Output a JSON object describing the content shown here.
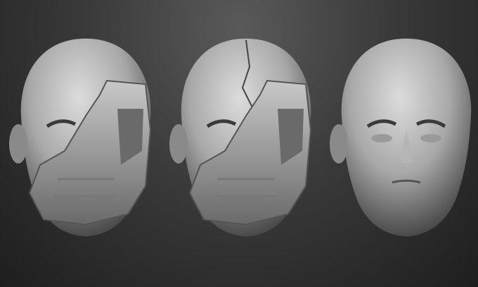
{
  "scene": {
    "background_top": "#5a5a5a",
    "background_bottom": "#1e1e1e",
    "clay_light": "#d6d6d6",
    "clay_dark": "#5e5e5e",
    "heads": [
      {
        "variant": "masked-head"
      },
      {
        "variant": "masked-head-cracked-skull"
      },
      {
        "variant": "bare-head"
      }
    ]
  }
}
